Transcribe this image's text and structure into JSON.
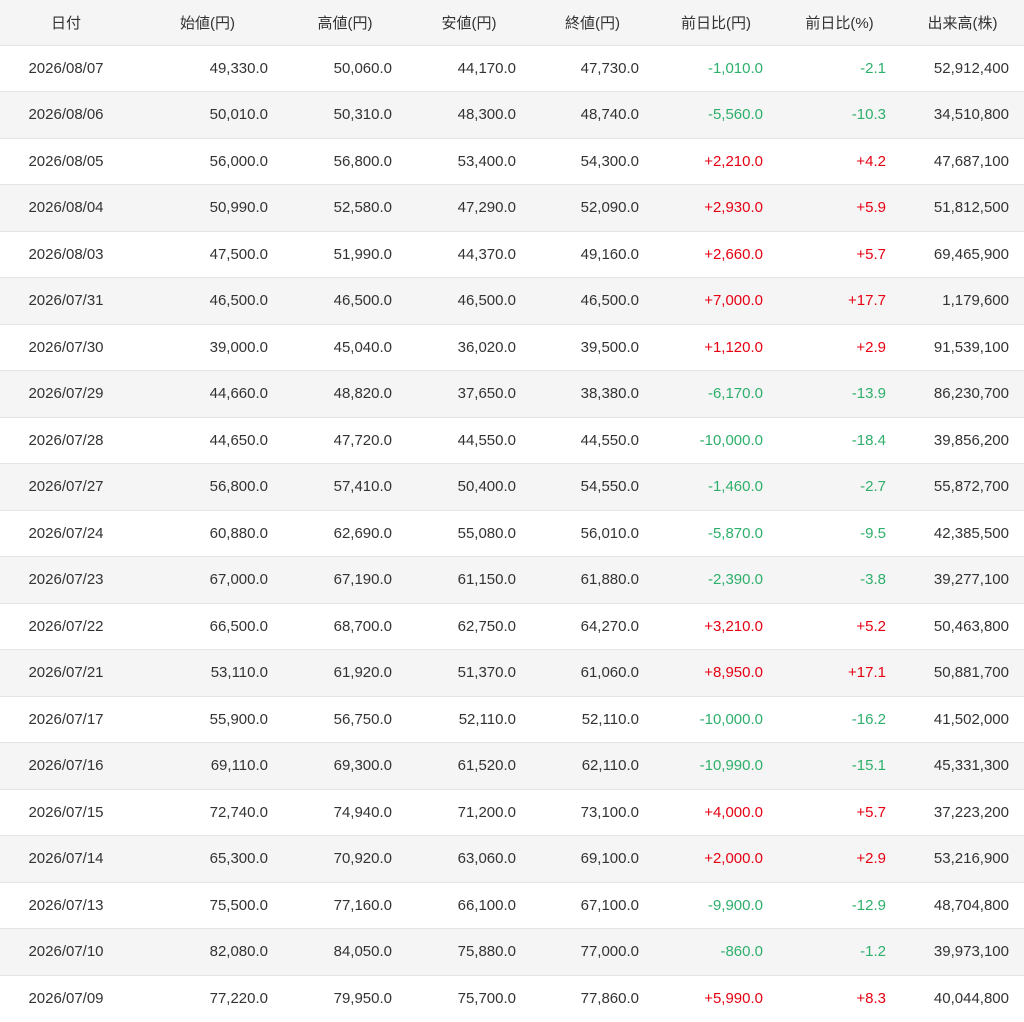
{
  "table": {
    "headers": [
      "日付",
      "始値(円)",
      "高値(円)",
      "安値(円)",
      "終値(円)",
      "前日比(円)",
      "前日比(%)",
      "出来高(株)"
    ],
    "colors": {
      "up": "#e60012",
      "down": "#2eaf6b"
    },
    "rows": [
      {
        "date": "2026/08/07",
        "open": "49,330.0",
        "high": "50,060.0",
        "low": "44,170.0",
        "close": "47,730.0",
        "change": "-1,010.0",
        "pct": "-2.1",
        "volume": "52,912,400",
        "trend": "down"
      },
      {
        "date": "2026/08/06",
        "open": "50,010.0",
        "high": "50,310.0",
        "low": "48,300.0",
        "close": "48,740.0",
        "change": "-5,560.0",
        "pct": "-10.3",
        "volume": "34,510,800",
        "trend": "down"
      },
      {
        "date": "2026/08/05",
        "open": "56,000.0",
        "high": "56,800.0",
        "low": "53,400.0",
        "close": "54,300.0",
        "change": "+2,210.0",
        "pct": "+4.2",
        "volume": "47,687,100",
        "trend": "up"
      },
      {
        "date": "2026/08/04",
        "open": "50,990.0",
        "high": "52,580.0",
        "low": "47,290.0",
        "close": "52,090.0",
        "change": "+2,930.0",
        "pct": "+5.9",
        "volume": "51,812,500",
        "trend": "up"
      },
      {
        "date": "2026/08/03",
        "open": "47,500.0",
        "high": "51,990.0",
        "low": "44,370.0",
        "close": "49,160.0",
        "change": "+2,660.0",
        "pct": "+5.7",
        "volume": "69,465,900",
        "trend": "up"
      },
      {
        "date": "2026/07/31",
        "open": "46,500.0",
        "high": "46,500.0",
        "low": "46,500.0",
        "close": "46,500.0",
        "change": "+7,000.0",
        "pct": "+17.7",
        "volume": "1,179,600",
        "trend": "up"
      },
      {
        "date": "2026/07/30",
        "open": "39,000.0",
        "high": "45,040.0",
        "low": "36,020.0",
        "close": "39,500.0",
        "change": "+1,120.0",
        "pct": "+2.9",
        "volume": "91,539,100",
        "trend": "up"
      },
      {
        "date": "2026/07/29",
        "open": "44,660.0",
        "high": "48,820.0",
        "low": "37,650.0",
        "close": "38,380.0",
        "change": "-6,170.0",
        "pct": "-13.9",
        "volume": "86,230,700",
        "trend": "down"
      },
      {
        "date": "2026/07/28",
        "open": "44,650.0",
        "high": "47,720.0",
        "low": "44,550.0",
        "close": "44,550.0",
        "change": "-10,000.0",
        "pct": "-18.4",
        "volume": "39,856,200",
        "trend": "down"
      },
      {
        "date": "2026/07/27",
        "open": "56,800.0",
        "high": "57,410.0",
        "low": "50,400.0",
        "close": "54,550.0",
        "change": "-1,460.0",
        "pct": "-2.7",
        "volume": "55,872,700",
        "trend": "down"
      },
      {
        "date": "2026/07/24",
        "open": "60,880.0",
        "high": "62,690.0",
        "low": "55,080.0",
        "close": "56,010.0",
        "change": "-5,870.0",
        "pct": "-9.5",
        "volume": "42,385,500",
        "trend": "down"
      },
      {
        "date": "2026/07/23",
        "open": "67,000.0",
        "high": "67,190.0",
        "low": "61,150.0",
        "close": "61,880.0",
        "change": "-2,390.0",
        "pct": "-3.8",
        "volume": "39,277,100",
        "trend": "down"
      },
      {
        "date": "2026/07/22",
        "open": "66,500.0",
        "high": "68,700.0",
        "low": "62,750.0",
        "close": "64,270.0",
        "change": "+3,210.0",
        "pct": "+5.2",
        "volume": "50,463,800",
        "trend": "up"
      },
      {
        "date": "2026/07/21",
        "open": "53,110.0",
        "high": "61,920.0",
        "low": "51,370.0",
        "close": "61,060.0",
        "change": "+8,950.0",
        "pct": "+17.1",
        "volume": "50,881,700",
        "trend": "up"
      },
      {
        "date": "2026/07/17",
        "open": "55,900.0",
        "high": "56,750.0",
        "low": "52,110.0",
        "close": "52,110.0",
        "change": "-10,000.0",
        "pct": "-16.2",
        "volume": "41,502,000",
        "trend": "down"
      },
      {
        "date": "2026/07/16",
        "open": "69,110.0",
        "high": "69,300.0",
        "low": "61,520.0",
        "close": "62,110.0",
        "change": "-10,990.0",
        "pct": "-15.1",
        "volume": "45,331,300",
        "trend": "down"
      },
      {
        "date": "2026/07/15",
        "open": "72,740.0",
        "high": "74,940.0",
        "low": "71,200.0",
        "close": "73,100.0",
        "change": "+4,000.0",
        "pct": "+5.7",
        "volume": "37,223,200",
        "trend": "up"
      },
      {
        "date": "2026/07/14",
        "open": "65,300.0",
        "high": "70,920.0",
        "low": "63,060.0",
        "close": "69,100.0",
        "change": "+2,000.0",
        "pct": "+2.9",
        "volume": "53,216,900",
        "trend": "up"
      },
      {
        "date": "2026/07/13",
        "open": "75,500.0",
        "high": "77,160.0",
        "low": "66,100.0",
        "close": "67,100.0",
        "change": "-9,900.0",
        "pct": "-12.9",
        "volume": "48,704,800",
        "trend": "down"
      },
      {
        "date": "2026/07/10",
        "open": "82,080.0",
        "high": "84,050.0",
        "low": "75,880.0",
        "close": "77,000.0",
        "change": "-860.0",
        "pct": "-1.2",
        "volume": "39,973,100",
        "trend": "down"
      },
      {
        "date": "2026/07/09",
        "open": "77,220.0",
        "high": "79,950.0",
        "low": "75,700.0",
        "close": "77,860.0",
        "change": "+5,990.0",
        "pct": "+8.3",
        "volume": "40,044,800",
        "trend": "up"
      }
    ]
  }
}
